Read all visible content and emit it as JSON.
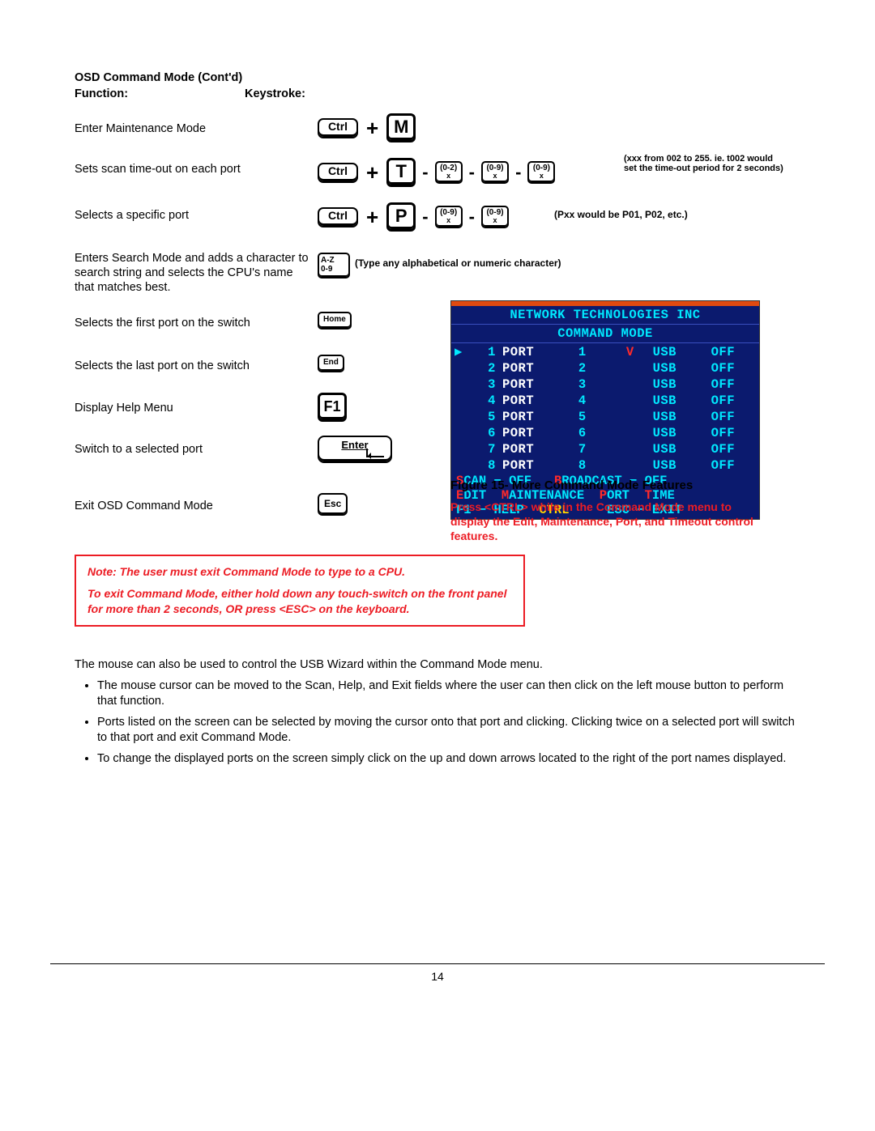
{
  "headers": {
    "title": "OSD Command Mode (Cont'd)",
    "function": "Function:",
    "keystroke": "Keystroke:"
  },
  "rows": {
    "r1": {
      "fn": "Enter Maintenance Mode",
      "ctrl": "Ctrl",
      "key": "M"
    },
    "r2": {
      "fn": "Sets scan time-out on each port",
      "ctrl": "Ctrl",
      "key": "T",
      "d1": "(0-2)",
      "d1x": "x",
      "d2": "(0-9)",
      "d2x": "x",
      "d3": "(0-9)",
      "d3x": "x",
      "note": "(xxx from 002 to 255.   ie.  t002 would set the time-out period for 2 seconds)"
    },
    "r3": {
      "fn": "Selects a specific port",
      "ctrl": "Ctrl",
      "key": "P",
      "d1": "(0-9)",
      "d1x": "x",
      "d2": "(0-9)",
      "d2x": "x",
      "note": "(Pxx would be P01, P02, etc.)"
    },
    "r4": {
      "fn": "Enters Search Mode and adds a character to search string and selects the CPU's name that matches best.",
      "az1": "A-Z",
      "az2": "0-9",
      "note": "(Type any alphabetical or numeric character)"
    },
    "r5": {
      "fn": "Selects the first port on the switch",
      "key": "Home"
    },
    "r6": {
      "fn": "Selects the last port on the switch",
      "key": "End"
    },
    "r7": {
      "fn": "Display Help Menu",
      "key": "F1"
    },
    "r8": {
      "fn": "Switch to a selected port",
      "key": "Enter"
    },
    "r9": {
      "fn": "Exit OSD Command Mode",
      "key": "Esc"
    }
  },
  "osd": {
    "title": "NETWORK  TECHNOLOGIES  INC",
    "subtitle": "COMMAND  MODE",
    "ports": [
      {
        "n": "1",
        "name": "PORT",
        "idx": "1",
        "flag": "V",
        "type": "USB",
        "st": "OFF",
        "sel": true
      },
      {
        "n": "2",
        "name": "PORT",
        "idx": "2",
        "flag": "",
        "type": "USB",
        "st": "OFF"
      },
      {
        "n": "3",
        "name": "PORT",
        "idx": "3",
        "flag": "",
        "type": "USB",
        "st": "OFF"
      },
      {
        "n": "4",
        "name": "PORT",
        "idx": "4",
        "flag": "",
        "type": "USB",
        "st": "OFF"
      },
      {
        "n": "5",
        "name": "PORT",
        "idx": "5",
        "flag": "",
        "type": "USB",
        "st": "OFF"
      },
      {
        "n": "6",
        "name": "PORT",
        "idx": "6",
        "flag": "",
        "type": "USB",
        "st": "OFF"
      },
      {
        "n": "7",
        "name": "PORT",
        "idx": "7",
        "flag": "",
        "type": "USB",
        "st": "OFF"
      },
      {
        "n": "8",
        "name": "PORT",
        "idx": "8",
        "flag": "",
        "type": "USB",
        "st": "OFF"
      }
    ],
    "footer1": {
      "s": "S",
      "can": "CAN  −  OFF",
      "b": "B",
      "roadcast": "ROADCAST  −  OFF"
    },
    "footer2": {
      "e": "E",
      "dit": "DIT",
      "m": "M",
      "aint": "AINTENANCE",
      "p": "P",
      "ort": "ORT",
      "t": "T",
      "ime": "IME"
    },
    "footer3": {
      "f1": "F1  −  HELP",
      "ctrl": "CTRL",
      "esc": "ESC  −  EXIT"
    }
  },
  "figcap": "Figure 15- More Command Mode Features",
  "redside": "Press <CTRL> while in the Command Mode menu to display the Edit, Maintenance, Port, and Timeout control features.",
  "redbox": {
    "l1": "Note:  The user must exit Command Mode to type to a CPU.",
    "l2": "To exit Command Mode, either hold down any touch-switch on the front panel for more than 2 seconds, OR  press <ESC> on the keyboard."
  },
  "body": {
    "intro": "The mouse can also be used to control the USB Wizard within the Command Mode menu.",
    "b1": "The mouse cursor can be moved to the Scan, Help, and Exit fields where the user can then click on the left mouse button to perform that function.",
    "b2": "Ports listed on the screen can be selected by moving the cursor onto that port and clicking.  Clicking twice on a selected port will switch to that port and exit Command Mode.",
    "b3": "To change the displayed ports on the screen simply click on the up and down arrows located to the right of the port names displayed."
  },
  "pagenum": "14"
}
